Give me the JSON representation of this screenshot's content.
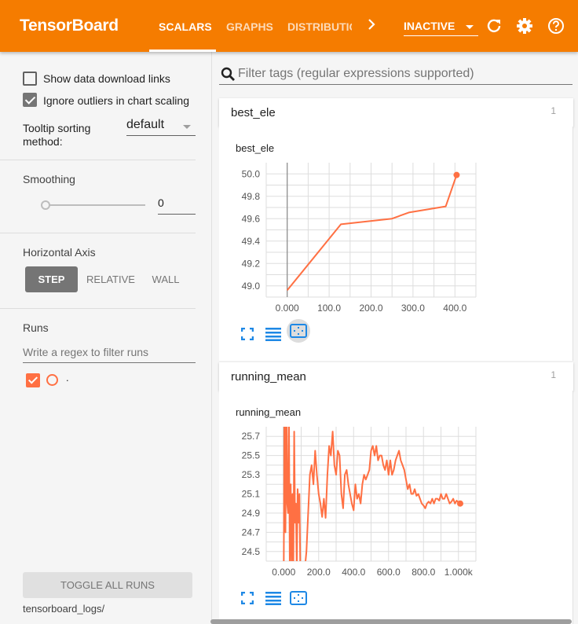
{
  "app": {
    "title": "TensorBoard"
  },
  "tabs": [
    {
      "label": "SCALARS",
      "active": true
    },
    {
      "label": "GRAPHS",
      "active": false
    },
    {
      "label": "DISTRIBUTIC",
      "active": false
    }
  ],
  "toolbar": {
    "more_icon": "chevron-right-icon",
    "status": "INACTIVE",
    "refresh_icon": "refresh-icon",
    "settings_icon": "gear-icon",
    "help_icon": "help-circle-icon"
  },
  "sidebar": {
    "show_download": {
      "label": "Show data download links",
      "checked": false
    },
    "ignore_outliers": {
      "label": "Ignore outliers in chart scaling",
      "checked": true
    },
    "tooltip_sort": {
      "label_line1": "Tooltip sorting",
      "label_line2": "method:",
      "value": "default"
    },
    "smoothing": {
      "title": "Smoothing",
      "value": "0",
      "slider_fraction": 0
    },
    "horizontal_axis": {
      "title": "Horizontal Axis",
      "options": [
        "STEP",
        "RELATIVE",
        "WALL"
      ],
      "selected": "STEP"
    },
    "runs": {
      "title": "Runs",
      "filter_placeholder": "Write a regex to filter runs",
      "items": [
        {
          "name": ".",
          "checked": true,
          "color": "#ff7043"
        }
      ]
    },
    "toggle_all": "TOGGLE ALL RUNS",
    "logdir": "tensorboard_logs/"
  },
  "main": {
    "filter_placeholder": "Filter tags (regular expressions supported)",
    "cards": [
      {
        "name": "best_ele",
        "count": "1",
        "chart_title": "best_ele"
      },
      {
        "name": "running_mean",
        "count": "1",
        "chart_title": "running_mean"
      }
    ]
  },
  "chart_data": [
    {
      "type": "line",
      "title": "best_ele",
      "xlabel": "",
      "ylabel": "",
      "xlim": [
        -50,
        450
      ],
      "ylim": [
        48.9,
        50.1
      ],
      "xticks": [
        0,
        100,
        200,
        300,
        400
      ],
      "xtick_labels": [
        "0.000",
        "100.0",
        "200.0",
        "300.0",
        "400.0"
      ],
      "yticks": [
        49.0,
        49.2,
        49.4,
        49.6,
        49.8,
        50.0
      ],
      "ytick_labels": [
        "49.0",
        "49.2",
        "49.4",
        "49.6",
        "49.8",
        "50.0"
      ],
      "grid": true,
      "color": "#ff7043",
      "series": [
        {
          "name": ".",
          "x": [
            0,
            128,
            250,
            290,
            378,
            404
          ],
          "y": [
            48.96,
            49.55,
            49.6,
            49.655,
            49.71,
            49.99
          ]
        }
      ]
    },
    {
      "type": "line",
      "title": "running_mean",
      "xlabel": "",
      "ylabel": "",
      "xlim": [
        -100,
        1100
      ],
      "ylim": [
        24.4,
        25.8
      ],
      "xticks": [
        0,
        200,
        400,
        600,
        800,
        1000
      ],
      "xtick_labels": [
        "0.000",
        "200.0",
        "400.0",
        "600.0",
        "800.0",
        "1.000k"
      ],
      "yticks": [
        24.5,
        24.7,
        24.9,
        25.1,
        25.3,
        25.5,
        25.7
      ],
      "ytick_labels": [
        "24.5",
        "24.7",
        "24.9",
        "25.1",
        "25.3",
        "25.5",
        "25.7"
      ],
      "grid": true,
      "color": "#ff7043",
      "series": [
        {
          "name": ".",
          "x": [
            0,
            5,
            10,
            15,
            20,
            25,
            30,
            35,
            40,
            45,
            50,
            55,
            60,
            65,
            70,
            75,
            80,
            85,
            90,
            95,
            100,
            110,
            120,
            130,
            140,
            150,
            160,
            170,
            180,
            190,
            200,
            210,
            220,
            230,
            240,
            250,
            260,
            270,
            280,
            290,
            300,
            310,
            320,
            330,
            340,
            350,
            360,
            370,
            380,
            390,
            400,
            410,
            420,
            430,
            440,
            450,
            460,
            470,
            480,
            490,
            500,
            510,
            520,
            530,
            540,
            550,
            560,
            570,
            580,
            590,
            600,
            610,
            620,
            630,
            640,
            650,
            660,
            670,
            680,
            690,
            700,
            710,
            720,
            730,
            740,
            750,
            760,
            770,
            780,
            790,
            800,
            810,
            820,
            830,
            840,
            850,
            860,
            870,
            880,
            890,
            900,
            910,
            920,
            930,
            940,
            950,
            960,
            970,
            980,
            990,
            1000,
            1010
          ],
          "y": [
            24.3,
            26.5,
            24.7,
            26.2,
            25.0,
            24.9,
            26.0,
            24.3,
            25.2,
            24.4,
            25.1,
            24.3,
            25.75,
            24.8,
            25.0,
            24.3,
            25.15,
            24.8,
            25.1,
            24.3,
            24.3,
            24.3,
            24.3,
            24.5,
            24.9,
            25.3,
            25.4,
            25.2,
            25.55,
            25.3,
            25.1,
            25.0,
            24.86,
            25.05,
            24.85,
            25.3,
            25.6,
            25.5,
            25.75,
            25.4,
            25.3,
            25.55,
            25.5,
            25.1,
            24.95,
            25.3,
            25.35,
            25.2,
            25.1,
            25.0,
            24.93,
            25.2,
            25.05,
            25.1,
            25.0,
            25.2,
            25.3,
            25.25,
            25.3,
            25.35,
            25.55,
            25.6,
            25.5,
            25.6,
            25.45,
            25.5,
            25.5,
            25.4,
            25.35,
            25.45,
            25.3,
            25.45,
            25.3,
            25.35,
            25.45,
            25.5,
            25.55,
            25.45,
            25.4,
            25.35,
            25.25,
            25.15,
            25.2,
            25.1,
            25.1,
            25.15,
            25.08,
            25.1,
            25.05,
            25.0,
            24.98,
            24.95,
            25.0,
            25.02,
            25.0,
            25.05,
            25.0,
            25.05,
            25.05,
            25.03,
            25.1,
            25.05,
            25.05,
            25.1,
            25.05,
            25.0,
            25.02,
            25.05,
            25.0,
            25.03,
            25.01,
            25.0
          ]
        }
      ]
    }
  ]
}
